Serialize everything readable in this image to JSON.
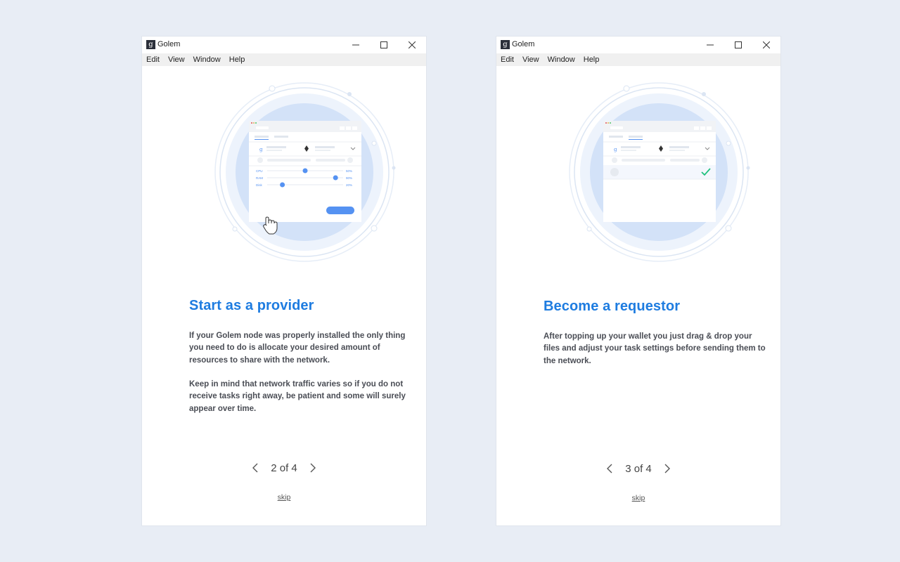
{
  "colors": {
    "accent": "#1e7ce0",
    "background": "#e8edf5",
    "slider": "#5592f2",
    "check": "#20c17e"
  },
  "windows": [
    {
      "title": "Golem",
      "logo": "g",
      "menu": [
        "Edit",
        "View",
        "Window",
        "Help"
      ],
      "heading": "Start as a provider",
      "paragraphs": [
        "If your Golem node was properly installed the only thing you need to do is allocate your desired amount of resources to share with the network.",
        "Keep in mind that network traffic varies so if you do not receive tasks right away, be patient and some will surely appear over time."
      ],
      "illustration": {
        "sliders": [
          {
            "label": "CPU",
            "value": "50%",
            "level": 0.5
          },
          {
            "label": "RAM",
            "value": "90%",
            "level": 0.9
          },
          {
            "label": "Disk",
            "value": "20%",
            "level": 0.2
          }
        ]
      },
      "pager": {
        "label": "2 of 4",
        "prev_icon": "chevron-left-icon",
        "next_icon": "chevron-right-icon"
      },
      "skip": "skip"
    },
    {
      "title": "Golem",
      "logo": "g",
      "menu": [
        "Edit",
        "View",
        "Window",
        "Help"
      ],
      "heading": "Become a requestor",
      "paragraphs": [
        "After topping up your wallet you just drag & drop your files and adjust your task settings before sending them to the network."
      ],
      "pager": {
        "label": "3 of 4",
        "prev_icon": "chevron-left-icon",
        "next_icon": "chevron-right-icon"
      },
      "skip": "skip"
    }
  ]
}
